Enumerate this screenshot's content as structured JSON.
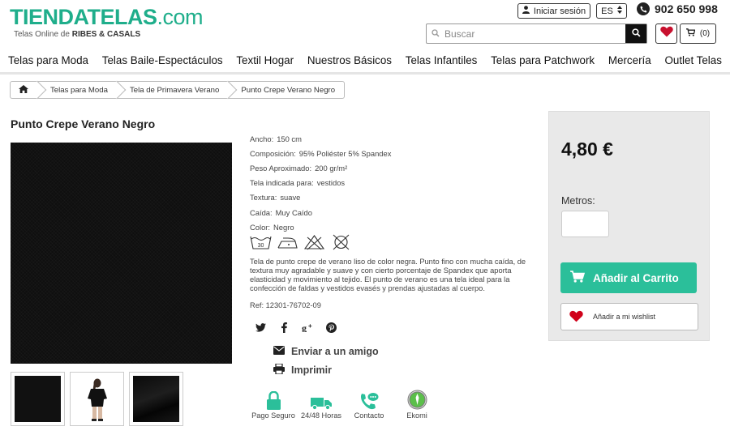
{
  "header": {
    "logo_main": "TIENDATELAS",
    "logo_suffix": ".com",
    "tagline_prefix": "Telas Online de ",
    "tagline_brand": "RIBES & CASALS",
    "login_label": "Iniciar sesión",
    "language": "ES",
    "phone": "902 650 998",
    "search_placeholder": "Buscar",
    "cart_count": "(0)"
  },
  "nav": {
    "items": [
      "Telas para Moda",
      "Telas Baile-Espectáculos",
      "Textil Hogar",
      "Nuestros Básicos",
      "Telas Infantiles",
      "Telas para Patchwork",
      "Mercería",
      "Outlet Telas"
    ]
  },
  "breadcrumb": {
    "items": [
      "Telas para Moda",
      "Tela de Primavera Verano",
      "Punto Crepe Verano Negro"
    ]
  },
  "product": {
    "title": "Punto Crepe Verano Negro",
    "specs": [
      {
        "key": "Ancho:",
        "value": "150 cm"
      },
      {
        "key": "Composición:",
        "value": "95% Poliéster  5% Spandex"
      },
      {
        "key": "Peso Aproximado:",
        "value": "200 gr/m²"
      },
      {
        "key": "Tela indicada para:",
        "value": "vestidos"
      },
      {
        "key": "Textura:",
        "value": "suave"
      },
      {
        "key": "Caída:",
        "value": "Muy Caído"
      },
      {
        "key": "Color:",
        "value": "Negro"
      }
    ],
    "wash_temp": "30",
    "description": "Tela de punto crepe de verano liso de color negra. Punto fino con mucha caída, de textura muy agradable y suave y con cierto porcentaje de Spandex que aporta elasticidad y movimiento al tejido. El punto de verano es una tela ideal para la confección de faldas y vestidos evasés y prendas ajustadas al cuerpo.",
    "ref": "Ref: 12301-76702-09"
  },
  "actions": {
    "send_friend": "Enviar a un amigo",
    "print": "Imprimir"
  },
  "trust": [
    "Pago Seguro",
    "24/48 Horas",
    "Contacto",
    "Ekomi"
  ],
  "buy": {
    "price": "4,80 €",
    "metros_label": "Metros:",
    "add_to_cart": "Añadir al Carrito",
    "add_to_wishlist": "Añadir a mi wishlist"
  },
  "colors": {
    "brand": "#1fae8b",
    "cta": "#2bbf9a",
    "heart": "#d0021b"
  }
}
